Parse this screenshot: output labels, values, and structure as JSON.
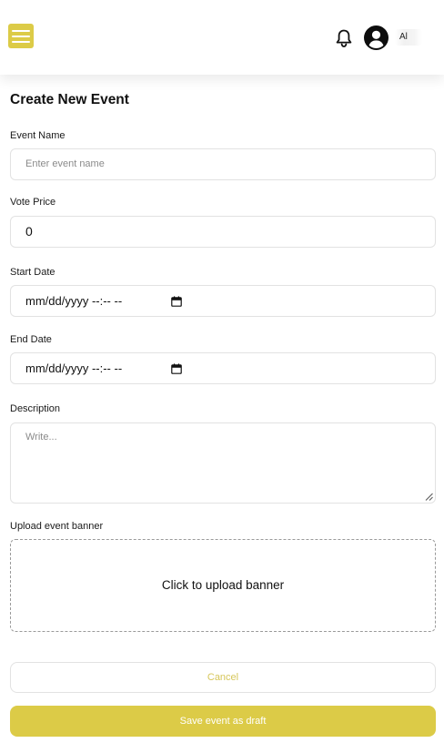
{
  "header": {
    "menu_icon": "hamburger-menu-icon",
    "notification_icon": "bell-icon",
    "avatar_icon": "user-circle-icon",
    "user_name": "Al",
    "accent_color": "#dccb47"
  },
  "form": {
    "title": "Create New Event",
    "event_name": {
      "label": "Event Name",
      "placeholder": "Enter event name",
      "value": ""
    },
    "vote_price": {
      "label": "Vote Price",
      "value": "0"
    },
    "start_date": {
      "label": "Start Date",
      "display": "mm/dd/yyyy --:-- --",
      "icon": "calendar-icon"
    },
    "end_date": {
      "label": "End Date",
      "display": "mm/dd/yyyy --:-- --",
      "icon": "calendar-icon"
    },
    "description": {
      "label": "Description",
      "placeholder": "Write..."
    },
    "banner": {
      "label": "Upload event banner",
      "prompt": "Click to upload banner"
    },
    "cancel_label": "Cancel",
    "save_label": "Save event as draft"
  }
}
